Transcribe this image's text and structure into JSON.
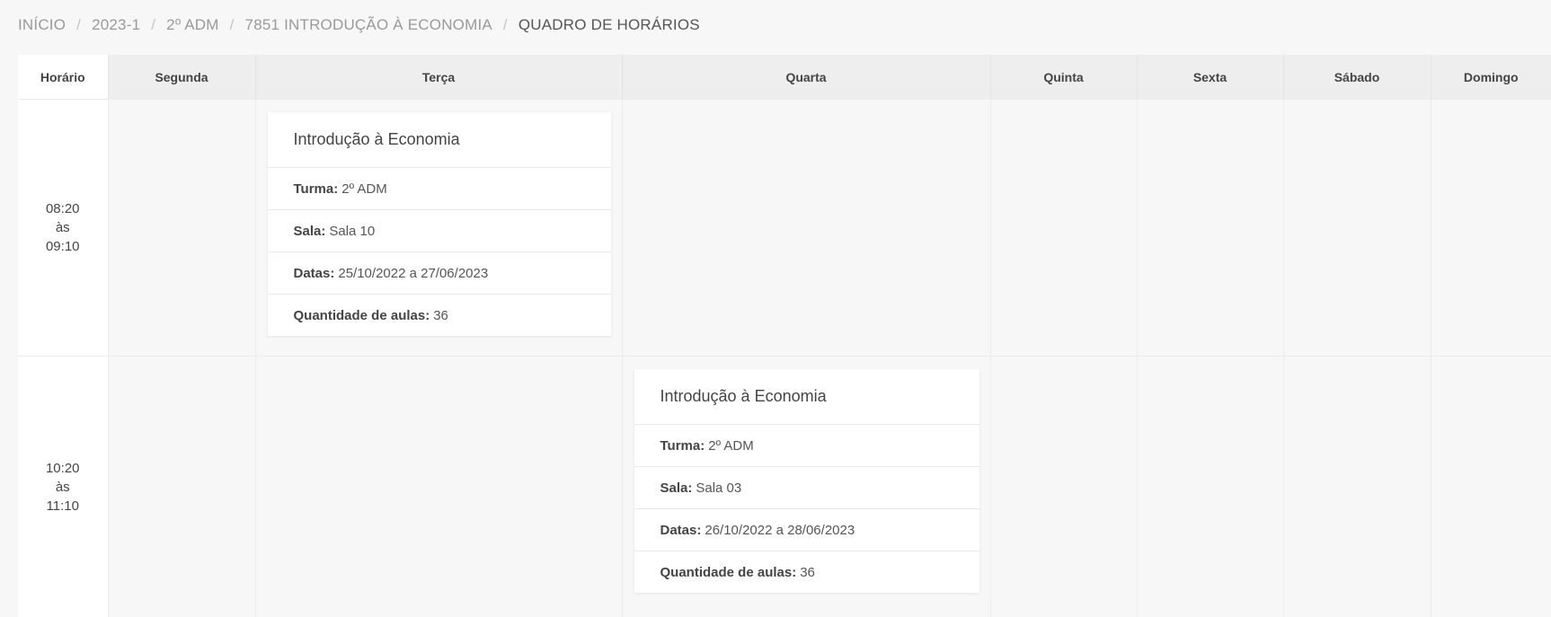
{
  "breadcrumb": {
    "items": [
      "INÍCIO",
      "2023-1",
      "2º ADM",
      "7851 INTRODUÇÃO À ECONOMIA"
    ],
    "current": "QUADRO DE HORÁRIOS",
    "separator": "/"
  },
  "table": {
    "headers": [
      "Horário",
      "Segunda",
      "Terça",
      "Quarta",
      "Quinta",
      "Sexta",
      "Sábado",
      "Domingo"
    ],
    "rows": [
      {
        "time": [
          "08:20",
          "às",
          "09:10"
        ],
        "card": {
          "title": "Introdução à Economia",
          "turma_label": "Turma:",
          "turma": "2º ADM",
          "sala_label": "Sala:",
          "sala": "Sala 10",
          "datas_label": "Datas:",
          "datas": "25/10/2022 a 27/06/2023",
          "qtd_label": "Quantidade de aulas:",
          "qtd": "36"
        }
      },
      {
        "time": [
          "10:20",
          "às",
          "11:10"
        ],
        "card": {
          "title": "Introdução à Economia",
          "turma_label": "Turma:",
          "turma": "2º ADM",
          "sala_label": "Sala:",
          "sala": "Sala 03",
          "datas_label": "Datas:",
          "datas": "26/10/2022 a 28/06/2023",
          "qtd_label": "Quantidade de aulas:",
          "qtd": "36"
        }
      }
    ]
  }
}
